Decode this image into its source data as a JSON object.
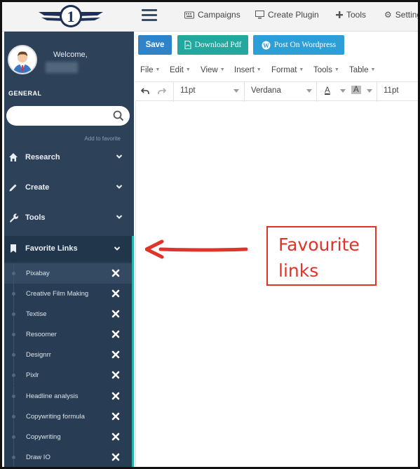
{
  "topbar": {
    "logo_text": "1",
    "items": [
      {
        "label": "Campaigns",
        "icon": "keyboard-icon"
      },
      {
        "label": "Create Plugin",
        "icon": "monitor-icon"
      },
      {
        "label": "Tools",
        "icon": "plus-icon"
      },
      {
        "label": "Settings",
        "icon": "gear-icon"
      }
    ]
  },
  "sidebar": {
    "welcome": "Welcome,",
    "section_title": "GENERAL",
    "search": {
      "value": "",
      "placeholder": ""
    },
    "add_favorite": "Add to favorite",
    "nav": [
      {
        "label": "Research",
        "icon": "home-icon"
      },
      {
        "label": "Create",
        "icon": "pencil-icon"
      },
      {
        "label": "Tools",
        "icon": "wrench-icon"
      },
      {
        "label": "Favorite Links",
        "icon": "bookmark-icon"
      }
    ],
    "favorites": [
      "Pixabay",
      "Creative Film Making",
      "Textise",
      "Resoomer",
      "Designrr",
      "Pixlr",
      "Headline analysis",
      "Copywriting formula",
      "Copywriting",
      "Draw IO"
    ]
  },
  "editor": {
    "buttons": {
      "save": "Save",
      "pdf": "Download Pdf",
      "wordpress": "Post On Wordpress"
    },
    "menus": [
      "File",
      "Edit",
      "View",
      "Insert",
      "Format",
      "Tools",
      "Table"
    ],
    "toolbar": {
      "font_size": "11pt",
      "font_family": "Verdana",
      "text_color_label": "A",
      "bg_color_label": "A",
      "font_size_2": "11pt"
    }
  },
  "annotation": {
    "line1": "Favourite",
    "line2": "links",
    "color": "#e0332a"
  },
  "colors": {
    "sidebar": "#2d4259",
    "accent_teal": "#23b3a8",
    "save_blue": "#2f84c9",
    "pdf_teal": "#23a89f",
    "wp_blue": "#2d9fd8"
  }
}
